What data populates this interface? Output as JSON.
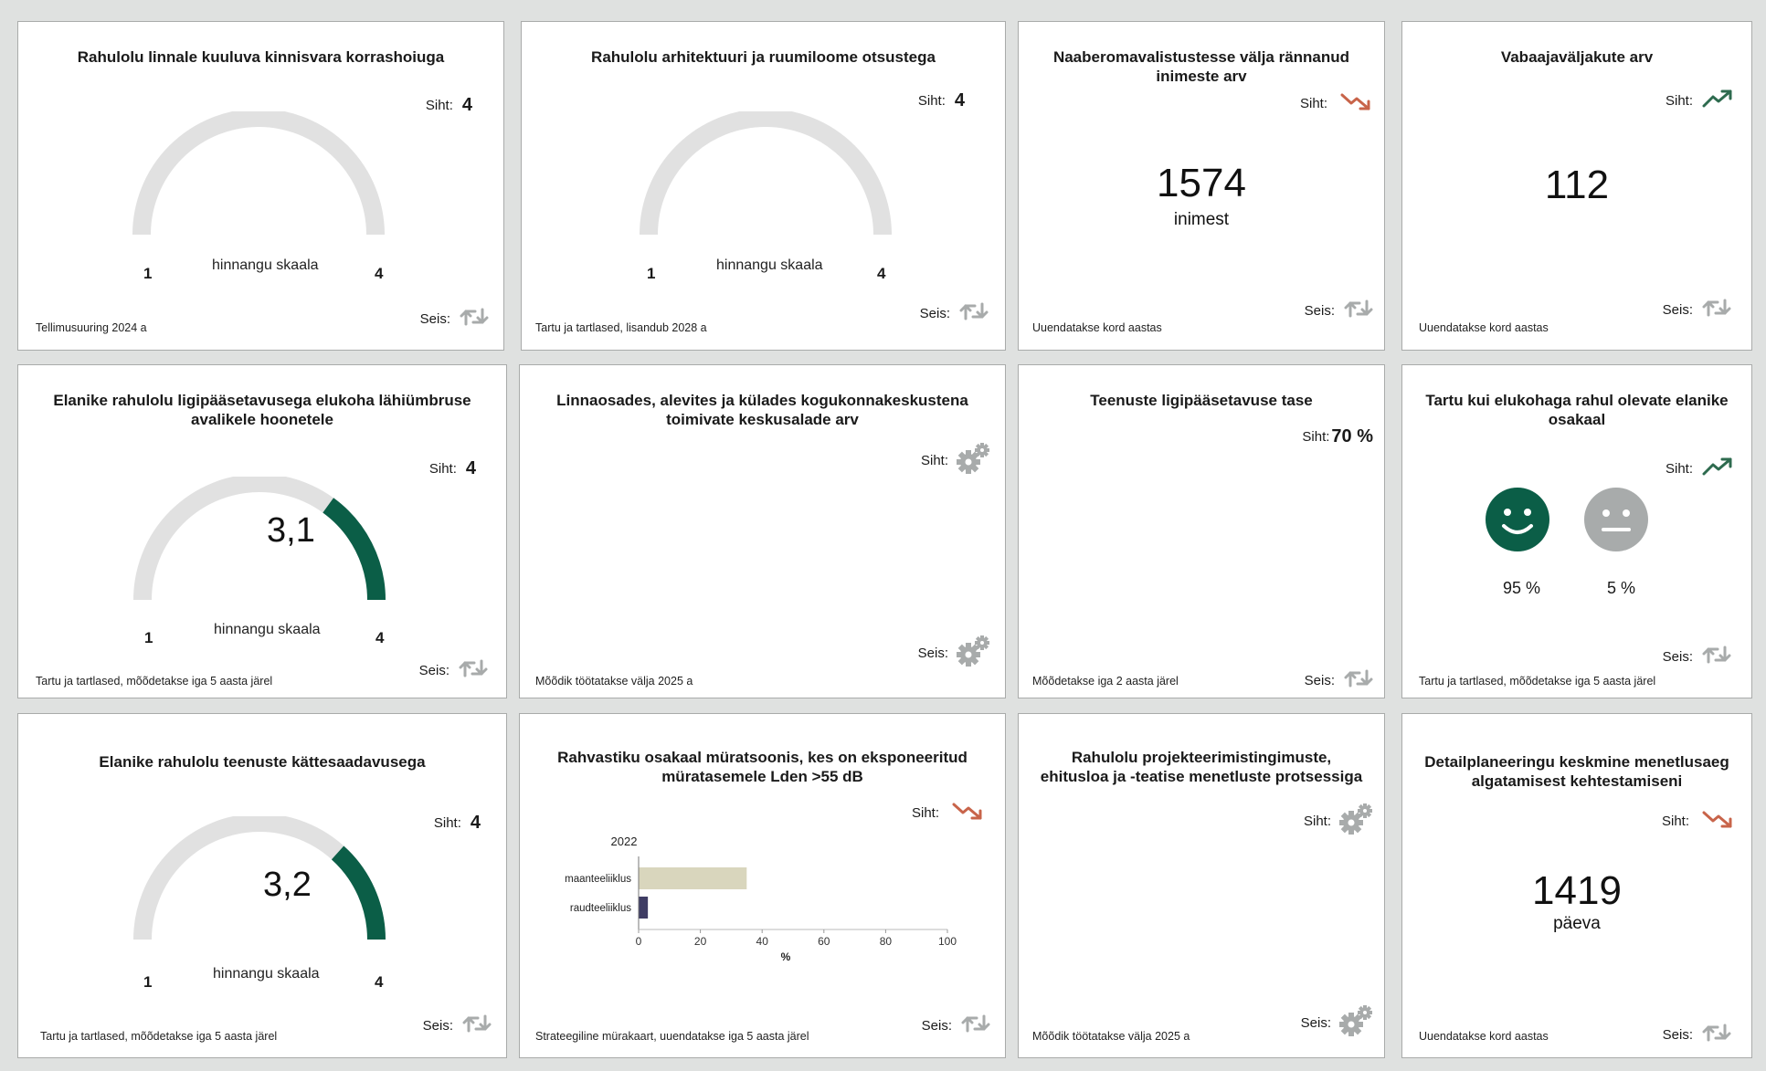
{
  "labels": {
    "target": "Siht:",
    "status": "Seis:",
    "scale": "hinnangu skaala",
    "min": "1",
    "max": "4"
  },
  "colors": {
    "accent": "#0b5e47",
    "track": "#e1e1e1",
    "down": "#c8644a",
    "up": "#2e6b4f",
    "icon_gray": "#a8abab",
    "bar1": "#d9d6bd",
    "bar2": "#3f3d64"
  },
  "cards": {
    "c1": {
      "title": "Rahulolu linnale kuuluva kinnisvara korrashoiuga",
      "target": "4",
      "note": "Tellimusuuring  2024 a"
    },
    "c2": {
      "title": "Rahulolu arhitektuuri ja ruumiloome otsustega",
      "target": "4",
      "note": "Tartu ja tartlased, lisandub 2028 a"
    },
    "c3": {
      "title": "Naaberomavalistustesse välja rännanud inimeste arv",
      "value": "1574",
      "unit": "inimest",
      "note": "Uuendatakse kord aastas",
      "trend": "down"
    },
    "c4": {
      "title": "Vabaajaväljakute arv",
      "value": "112",
      "note": "Uuendatakse kord aastas",
      "trend": "up"
    },
    "c5": {
      "title": "Elanike rahulolu ligipääsetavusega elukoha lähiümbruse avalikele hoonetele",
      "target": "4",
      "value": "3,1",
      "value_num": 3.1,
      "note": "Tartu ja tartlased, mõõdetakse iga 5 aasta järel"
    },
    "c6": {
      "title": "Linnaosades, alevites ja külades kogukonnakeskustena toimivate keskusalade arv",
      "note": "Mõõdik töötatakse välja 2025 a"
    },
    "c7": {
      "title": "Teenuste ligipääsetavuse tase",
      "target": "70 %",
      "note": "Mõõdetakse iga 2 aasta järel"
    },
    "c8": {
      "title": "Tartu kui elukohaga rahul olevate elanike osakaal",
      "pct_happy": "95 %",
      "pct_neutral": "5 %",
      "note": "Tartu ja tartlased, mõõdetakse iga 5 aasta järel",
      "trend": "up"
    },
    "c9": {
      "title": "Elanike rahulolu teenuste kättesaadavusega",
      "target": "4",
      "value": "3,2",
      "value_num": 3.2,
      "note": "Tartu ja tartlased, mõõdetakse iga 5 aasta järel"
    },
    "c10": {
      "title": "Rahvastiku osakaal müratsoonis, kes on eksponeeritud müratasemele Lden >55 dB",
      "note": "Strateegiline mürakaart, uuendatakse iga 5 aasta järel",
      "trend": "down"
    },
    "c11": {
      "title": "Rahulolu projekteerimistingimuste, ehitusloa ja -teatise menetluste protsessiga",
      "note": "Mõõdik töötatakse välja 2025 a"
    },
    "c12": {
      "title": "Detailplaneeringu keskmine menetlusaeg algatamisest kehtestamiseni",
      "value": "1419",
      "unit": "päeva",
      "note": "Uuendatakse kord aastas",
      "trend": "down"
    }
  },
  "chart_data": {
    "type": "bar",
    "orientation": "horizontal",
    "title": "2022",
    "categories": [
      "maanteeliiklus",
      "raudteeliiklus"
    ],
    "values": [
      35,
      3
    ],
    "xlabel": "%",
    "xlim": [
      0,
      100
    ],
    "xticks": [
      "0",
      "20",
      "40",
      "60",
      "80",
      "100"
    ],
    "grid": false
  }
}
